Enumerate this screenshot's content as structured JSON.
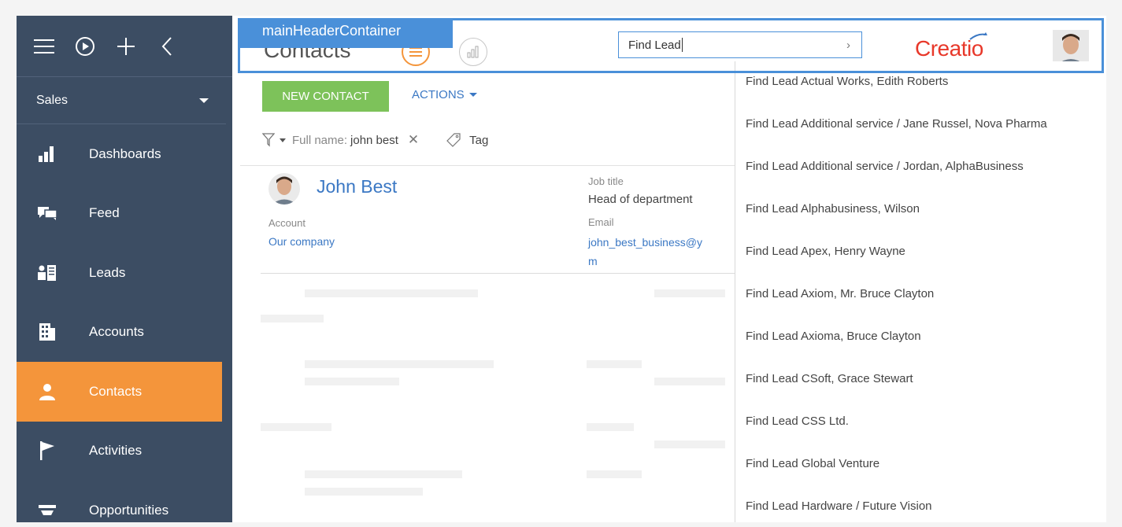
{
  "sidebar": {
    "workplace": "Sales",
    "items": [
      {
        "label": "Dashboards",
        "icon": "dashboard-icon",
        "active": false
      },
      {
        "label": "Feed",
        "icon": "feed-icon",
        "active": false
      },
      {
        "label": "Leads",
        "icon": "leads-icon",
        "active": false
      },
      {
        "label": "Accounts",
        "icon": "accounts-icon",
        "active": false
      },
      {
        "label": "Contacts",
        "icon": "contacts-icon",
        "active": true
      },
      {
        "label": "Activities",
        "icon": "flag-icon",
        "active": false
      },
      {
        "label": "Opportunities",
        "icon": "funnel-icon",
        "active": false
      }
    ]
  },
  "header": {
    "title": "Contacts",
    "overlay_label": "mainHeaderContainer",
    "search_value": "Find Lead",
    "logo_text": "Creatio"
  },
  "toolbar": {
    "new_label": "NEW CONTACT",
    "actions_label": "ACTIONS"
  },
  "filter": {
    "label": "Full name:",
    "value": "john best",
    "tag_label": "Tag"
  },
  "contact": {
    "name": "John Best",
    "account_label": "Account",
    "account_value": "Our company",
    "job_label": "Job title",
    "job_value": "Head of department",
    "email_label": "Email",
    "email_line1": "john_best_business@y",
    "email_line2": "m"
  },
  "dropdown": {
    "items": [
      "Find Lead Actual Works, Edith Roberts",
      "Find Lead Additional service / Jane Russel, Nova Pharma",
      "Find Lead Additional service / Jordan, AlphaBusiness",
      "Find Lead Alphabusiness, Wilson",
      "Find Lead Apex, Henry Wayne",
      "Find Lead Axiom, Mr. Bruce Clayton",
      "Find Lead Axioma, Bruce Clayton",
      "Find Lead CSoft, Grace Stewart",
      "Find Lead CSS Ltd.",
      "Find Lead Global Venture",
      "Find Lead Hardware / Future Vision"
    ]
  },
  "colors": {
    "sidebar_bg": "#3c4d63",
    "accent_orange": "#f4953b",
    "link_blue": "#3b78c4",
    "button_green": "#7dc25a",
    "highlight_blue": "#4a90d9",
    "logo_red": "#e8382a"
  }
}
